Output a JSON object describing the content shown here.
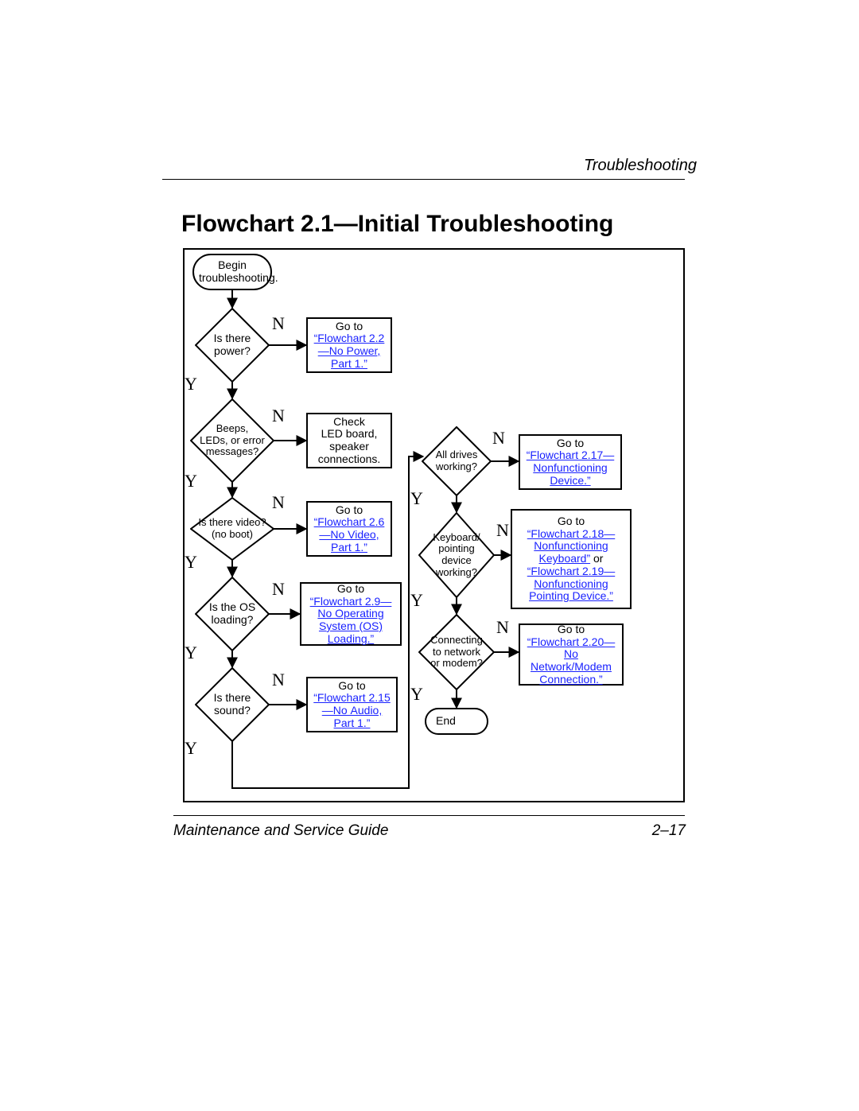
{
  "header": {
    "section": "Troubleshooting"
  },
  "title": "Flowchart 2.1—Initial Troubleshooting",
  "footer": {
    "left": "Maintenance and Service Guide",
    "right": "2–17"
  },
  "nodes": {
    "begin": {
      "line1": "Begin",
      "line2": "troubleshooting."
    },
    "d_power": {
      "line1": "Is there",
      "line2": "power?"
    },
    "a_power": {
      "pre": "Go to",
      "link": "“Flowchart 2.2—No Power, Part 1.”"
    },
    "d_beeps": {
      "line1": "Beeps,",
      "line2": "LEDs, or error",
      "line3": "messages?"
    },
    "a_beeps": {
      "line1": "Check",
      "line2": "LED board,",
      "line3": "speaker",
      "line4": "connections."
    },
    "d_video": {
      "line1": "Is there video?",
      "line2": "(no boot)"
    },
    "a_video": {
      "pre": "Go to",
      "link": "“Flowchart 2.6—No Video, Part 1.”"
    },
    "d_os": {
      "line1": "Is the OS",
      "line2": "loading?"
    },
    "a_os": {
      "pre": "Go to",
      "link": "“Flowchart 2.9—No Operating System (OS) Loading.”"
    },
    "d_sound": {
      "line1": "Is there",
      "line2": "sound?"
    },
    "a_sound": {
      "pre": "Go to",
      "link": "“Flowchart 2.15—No Audio, Part 1.”"
    },
    "d_drives": {
      "line1": "All drives",
      "line2": "working?"
    },
    "a_drives": {
      "pre": "Go to",
      "link": "“Flowchart 2.17—Nonfunctioning Device.”"
    },
    "d_kbd": {
      "line1": "Keyboard/",
      "line2": "pointing",
      "line3": "device",
      "line4": "working?"
    },
    "a_kbd": {
      "pre": "Go to",
      "link1": "“Flowchart 2.18—Nonfunctioning Keyboard”",
      "mid": "or",
      "link2": "“Flowchart 2.19—Nonfunctioning Pointing Device.”"
    },
    "d_net": {
      "line1": "Connecting",
      "line2": "to network",
      "line3": "or modem?"
    },
    "a_net": {
      "pre": "Go to",
      "link": "“Flowchart 2.20—No Network/Modem Connection.”"
    },
    "end": {
      "text": "End"
    }
  },
  "labels": {
    "yes": "Y",
    "no": "N"
  },
  "chart_data": {
    "type": "flowchart",
    "title": "Flowchart 2.1 — Initial Troubleshooting",
    "nodes": [
      {
        "id": "begin",
        "kind": "terminator",
        "text": "Begin troubleshooting."
      },
      {
        "id": "d_power",
        "kind": "decision",
        "text": "Is there power?"
      },
      {
        "id": "a_power",
        "kind": "process",
        "text": "Go to \"Flowchart 2.2—No Power, Part 1.\""
      },
      {
        "id": "d_beeps",
        "kind": "decision",
        "text": "Beeps, LEDs, or error messages?"
      },
      {
        "id": "a_beeps",
        "kind": "process",
        "text": "Check LED board, speaker connections."
      },
      {
        "id": "d_video",
        "kind": "decision",
        "text": "Is there video? (no boot)"
      },
      {
        "id": "a_video",
        "kind": "process",
        "text": "Go to \"Flowchart 2.6—No Video, Part 1.\""
      },
      {
        "id": "d_os",
        "kind": "decision",
        "text": "Is the OS loading?"
      },
      {
        "id": "a_os",
        "kind": "process",
        "text": "Go to \"Flowchart 2.9—No Operating System (OS) Loading.\""
      },
      {
        "id": "d_sound",
        "kind": "decision",
        "text": "Is there sound?"
      },
      {
        "id": "a_sound",
        "kind": "process",
        "text": "Go to \"Flowchart 2.15—No Audio, Part 1.\""
      },
      {
        "id": "d_drives",
        "kind": "decision",
        "text": "All drives working?"
      },
      {
        "id": "a_drives",
        "kind": "process",
        "text": "Go to \"Flowchart 2.17—Nonfunctioning Device.\""
      },
      {
        "id": "d_kbd",
        "kind": "decision",
        "text": "Keyboard/pointing device working?"
      },
      {
        "id": "a_kbd",
        "kind": "process",
        "text": "Go to \"Flowchart 2.18—Nonfunctioning Keyboard\" or \"Flowchart 2.19—Nonfunctioning Pointing Device.\""
      },
      {
        "id": "d_net",
        "kind": "decision",
        "text": "Connecting to network or modem?"
      },
      {
        "id": "a_net",
        "kind": "process",
        "text": "Go to \"Flowchart 2.20—No Network/Modem Connection.\""
      },
      {
        "id": "end",
        "kind": "terminator",
        "text": "End"
      }
    ],
    "edges": [
      {
        "from": "begin",
        "to": "d_power"
      },
      {
        "from": "d_power",
        "to": "a_power",
        "label": "N"
      },
      {
        "from": "d_power",
        "to": "d_beeps",
        "label": "Y"
      },
      {
        "from": "d_beeps",
        "to": "a_beeps",
        "label": "N"
      },
      {
        "from": "d_beeps",
        "to": "d_video",
        "label": "Y"
      },
      {
        "from": "d_video",
        "to": "a_video",
        "label": "N"
      },
      {
        "from": "d_video",
        "to": "d_os",
        "label": "Y"
      },
      {
        "from": "d_os",
        "to": "a_os",
        "label": "N"
      },
      {
        "from": "d_os",
        "to": "d_sound",
        "label": "Y"
      },
      {
        "from": "d_sound",
        "to": "a_sound",
        "label": "N"
      },
      {
        "from": "d_sound",
        "to": "d_drives",
        "label": "Y"
      },
      {
        "from": "d_drives",
        "to": "a_drives",
        "label": "N"
      },
      {
        "from": "d_drives",
        "to": "d_kbd",
        "label": "Y"
      },
      {
        "from": "d_kbd",
        "to": "a_kbd",
        "label": "N"
      },
      {
        "from": "d_kbd",
        "to": "d_net",
        "label": "Y"
      },
      {
        "from": "d_net",
        "to": "a_net",
        "label": "N"
      },
      {
        "from": "d_net",
        "to": "end",
        "label": "Y"
      }
    ]
  }
}
